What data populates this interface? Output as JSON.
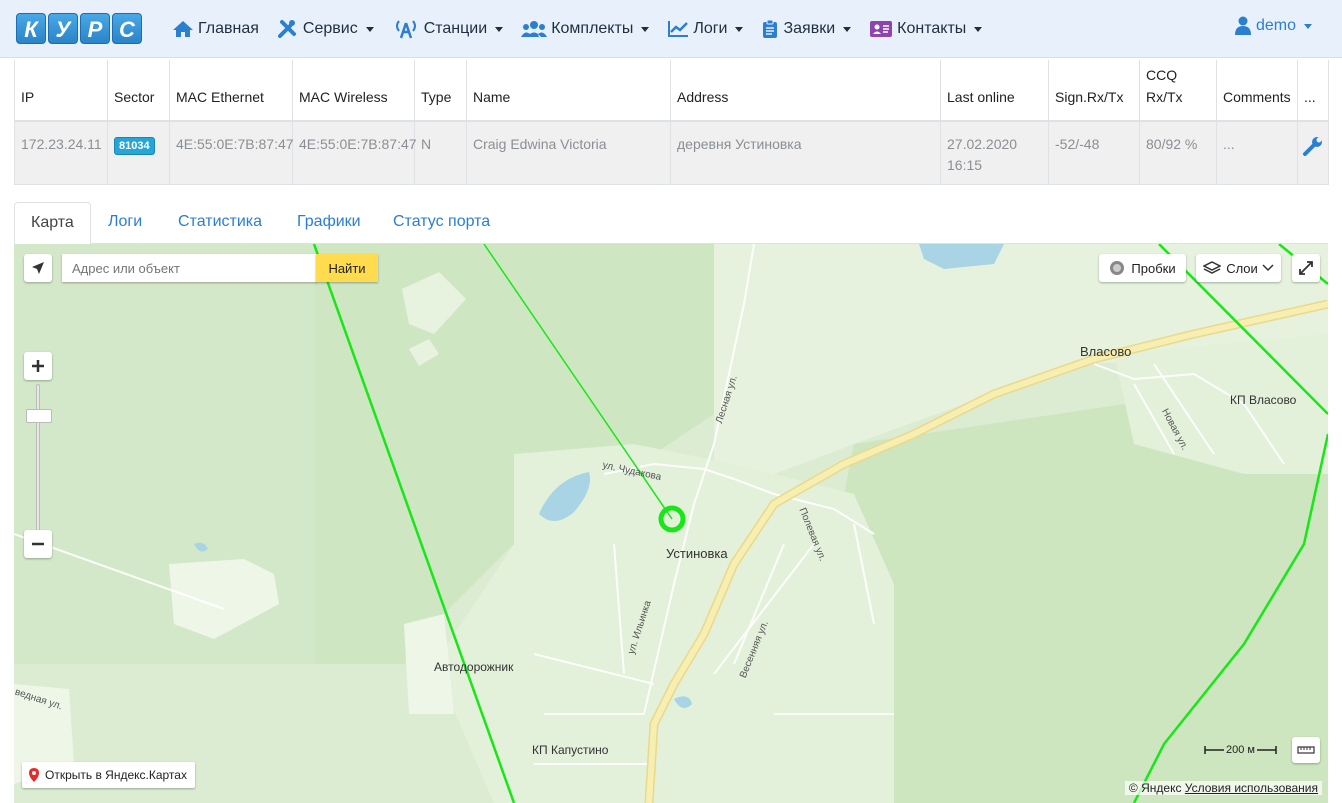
{
  "brand": {
    "letters": [
      "К",
      "У",
      "Р",
      "С"
    ]
  },
  "nav": {
    "items": [
      {
        "label": "Главная",
        "icon": "home-icon",
        "dropdown": false
      },
      {
        "label": "Сервис",
        "icon": "tools-icon",
        "dropdown": true
      },
      {
        "label": "Станции",
        "icon": "antenna-icon",
        "dropdown": true
      },
      {
        "label": "Комплекты",
        "icon": "users-icon",
        "dropdown": true
      },
      {
        "label": "Логи",
        "icon": "chart-line-icon",
        "dropdown": true
      },
      {
        "label": "Заявки",
        "icon": "clipboard-icon",
        "dropdown": true
      },
      {
        "label": "Контакты",
        "icon": "contact-card-icon",
        "dropdown": true
      }
    ],
    "user": "demo"
  },
  "table": {
    "headers": [
      "IP",
      "Sector",
      "MAC Ethernet",
      "MAC Wireless",
      "Type",
      "Name",
      "Address",
      "Last online",
      "Sign.Rx/Tx",
      "CCQ Rx/Tx",
      "Comments",
      "..."
    ],
    "row": {
      "ip": "172.23.24.11",
      "sector": "81034",
      "mac_ethernet": "4E:55:0E:7B:87:47",
      "mac_wireless": "4E:55:0E:7B:87:47",
      "type": "N",
      "name": "Craig Edwina Victoria",
      "address": "деревня Устиновка",
      "last_online": "27.02.2020 16:15",
      "signal": "-52/-48",
      "ccq": "80/92 %",
      "comments": "..."
    }
  },
  "tabs": [
    {
      "label": "Карта",
      "active": true
    },
    {
      "label": "Логи",
      "active": false
    },
    {
      "label": "Статистика",
      "active": false
    },
    {
      "label": "Графики",
      "active": false
    },
    {
      "label": "Статус порта",
      "active": false
    }
  ],
  "map": {
    "search_placeholder": "Адрес или объект",
    "search_button": "Найти",
    "traffic_label": "Пробки",
    "layers_label": "Слои",
    "open_link": "Открыть в Яндекс.Картах",
    "scale": "200 м",
    "copyright": "© Яндекс",
    "terms": "Условия использования",
    "labels": {
      "vlasovo": "Власово",
      "kp_vlasovo": "КП Власово",
      "ustinovka": "Устиновка",
      "avtodorozhnik": "Автодорожник",
      "kp_kapustino": "КП Капустино",
      "lesnaya": "Лесная ул.",
      "chudakova": "ул. Чудакова",
      "polevaya": "Полевая ул.",
      "ilyinka": "ул. Ильинка",
      "vesennyaya": "Весенняя ул.",
      "novaya": "Новая ул.",
      "vednaya": "ведная ул."
    },
    "colors": {
      "sector": "#19e619",
      "road": "#f3e89a",
      "forest": "#cfe8c0"
    }
  }
}
